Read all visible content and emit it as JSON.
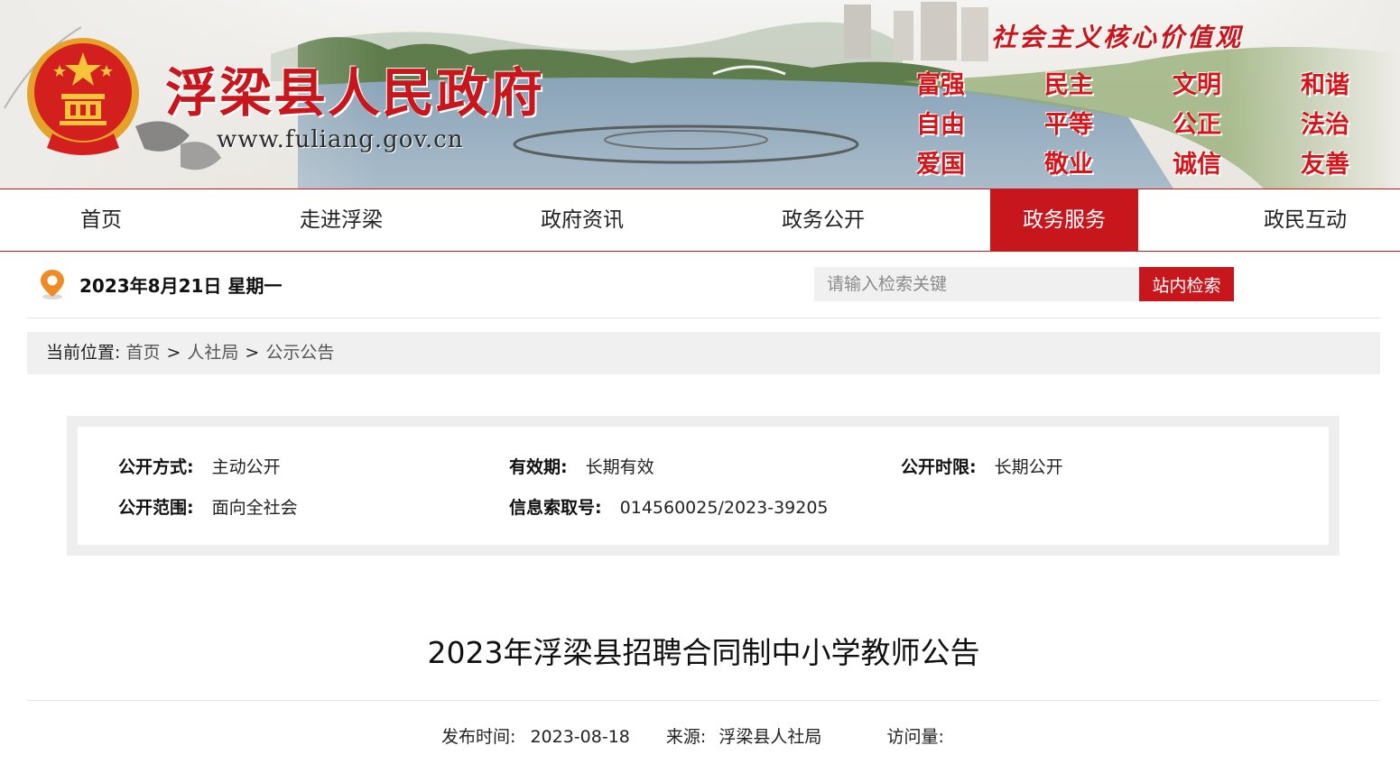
{
  "header": {
    "site_name": "浮梁县人民政府",
    "site_url": "www.fuliang.gov.cn",
    "values_title": "社会主义核心价值观",
    "core_values": [
      "富强",
      "民主",
      "文明",
      "和谐",
      "自由",
      "平等",
      "公正",
      "法治",
      "爱国",
      "敬业",
      "诚信",
      "友善"
    ],
    "brand_color": "#c8161d"
  },
  "nav": {
    "items": [
      {
        "label": "首页"
      },
      {
        "label": "走进浮梁"
      },
      {
        "label": "政府资讯"
      },
      {
        "label": "政务公开"
      },
      {
        "label": "政务服务"
      },
      {
        "label": "政民互动"
      }
    ],
    "active": "政务服务"
  },
  "infobar": {
    "date": "2023年8月21日 星期一",
    "search_placeholder": "请输入检索关键",
    "search_button": "站内检索"
  },
  "breadcrumb": {
    "label": "当前位置:",
    "items": [
      "首页",
      "人社局",
      "公示公告"
    ],
    "separator": ">"
  },
  "meta": {
    "disclosure_method_label": "公开方式:",
    "disclosure_method": "主动公开",
    "validity_label": "有效期:",
    "validity": "长期有效",
    "disclosure_period_label": "公开时限:",
    "disclosure_period": "长期公开",
    "scope_label": "公开范围:",
    "scope": "面向全社会",
    "index_label": "信息索取号:",
    "index_number": "014560025/2023-39205"
  },
  "article": {
    "title": "2023年浮梁县招聘合同制中小学教师公告",
    "publish_label": "发布时间:",
    "publish_date": "2023-08-18",
    "source_label": "来源:",
    "source": "浮梁县人社局",
    "views_label": "访问量:"
  }
}
